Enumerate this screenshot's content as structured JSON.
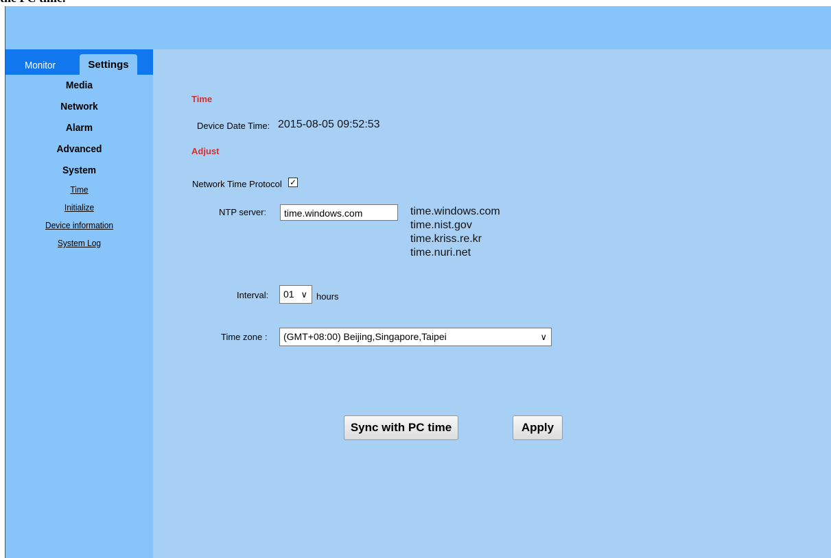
{
  "page": {
    "top_caption": "the PC time."
  },
  "tabs": {
    "monitor": "Monitor",
    "settings": "Settings"
  },
  "sidebar": {
    "items": [
      "Media",
      "Network",
      "Alarm",
      "Advanced",
      "System"
    ],
    "sub_items": [
      "Time",
      "Initialize",
      "Device information",
      "System Log"
    ]
  },
  "time_section": {
    "title": "Time",
    "device_date_time_label": "Device Date Time:",
    "device_date_time_value": "2015-08-05 09:52:53"
  },
  "adjust_section": {
    "title": "Adjust",
    "ntp_label": "Network Time Protocol",
    "ntp_checked": true,
    "ntp_server_label": "NTP server:",
    "ntp_server_value": "time.windows.com",
    "ntp_servers": [
      "time.windows.com",
      "time.nist.gov",
      "time.kriss.re.kr",
      "time.nuri.net"
    ],
    "interval_label": "Interval:",
    "interval_value": "01",
    "interval_unit": "hours",
    "timezone_label": "Time zone :",
    "timezone_value": "(GMT+08:00) Beijing,Singapore,Taipei"
  },
  "buttons": {
    "sync": "Sync with PC time",
    "apply": "Apply"
  },
  "colors": {
    "header_band": "#87c4fa",
    "content_bg": "#a8d0f5",
    "tab_bar": "#1177ee",
    "section_title": "#cc3333"
  },
  "icons": {
    "checkbox": "checkmark-icon",
    "dropdown": "chevron-down-icon"
  }
}
